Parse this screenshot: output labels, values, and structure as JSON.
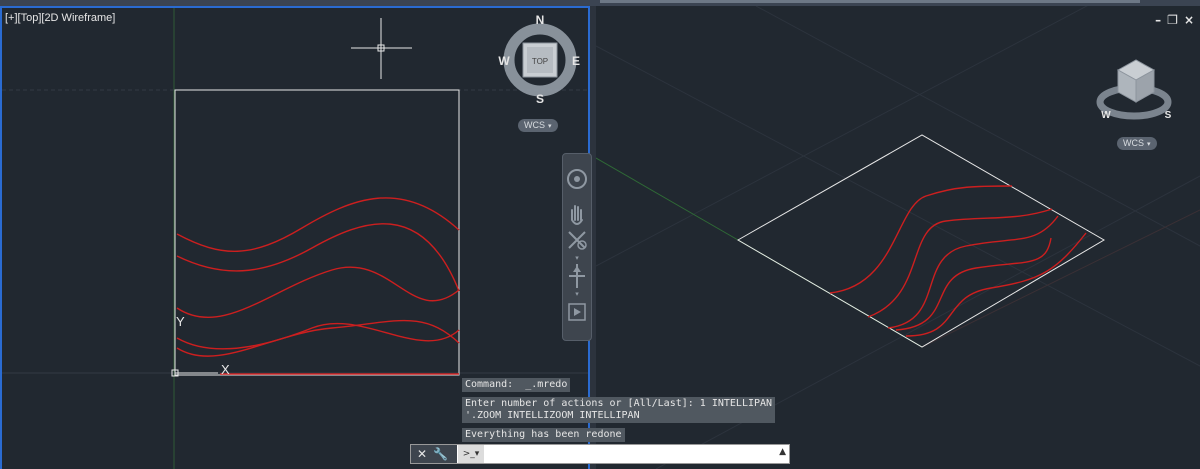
{
  "viewports": {
    "left": {
      "label": "[+][Top][2D Wireframe]",
      "compass": {
        "n": "N",
        "s": "S",
        "e": "E",
        "w": "W",
        "cube_face": "TOP"
      },
      "wcs": "WCS",
      "ucs_y": "Y",
      "ucs_x": "X"
    },
    "right": {
      "wcs": "WCS",
      "compass": {
        "w": "W",
        "s": "S"
      },
      "controls": {
        "minimize": "–",
        "restore": "❐",
        "close": "×"
      }
    }
  },
  "command": {
    "history": [
      "Command:  _.mredo",
      "Enter number of actions or [All/Last]: 1 INTELLIPAN\n'.ZOOM INTELLIZOOM INTELLIPAN",
      "Everything has been redone"
    ],
    "input_value": "",
    "input_placeholder": ""
  },
  "icons": [
    "steering-wheel-icon",
    "pan-icon",
    "zoom-extents-icon",
    "orbit-icon",
    "showmotion-icon",
    "close-icon",
    "wrench-icon",
    "command-prompt-icon",
    "chevron-up-icon"
  ],
  "colors": {
    "viewport_bg": "#212830",
    "active_border": "#2a6bd1",
    "curve": "#cc1f1f",
    "wire": "#e8e8e8"
  }
}
